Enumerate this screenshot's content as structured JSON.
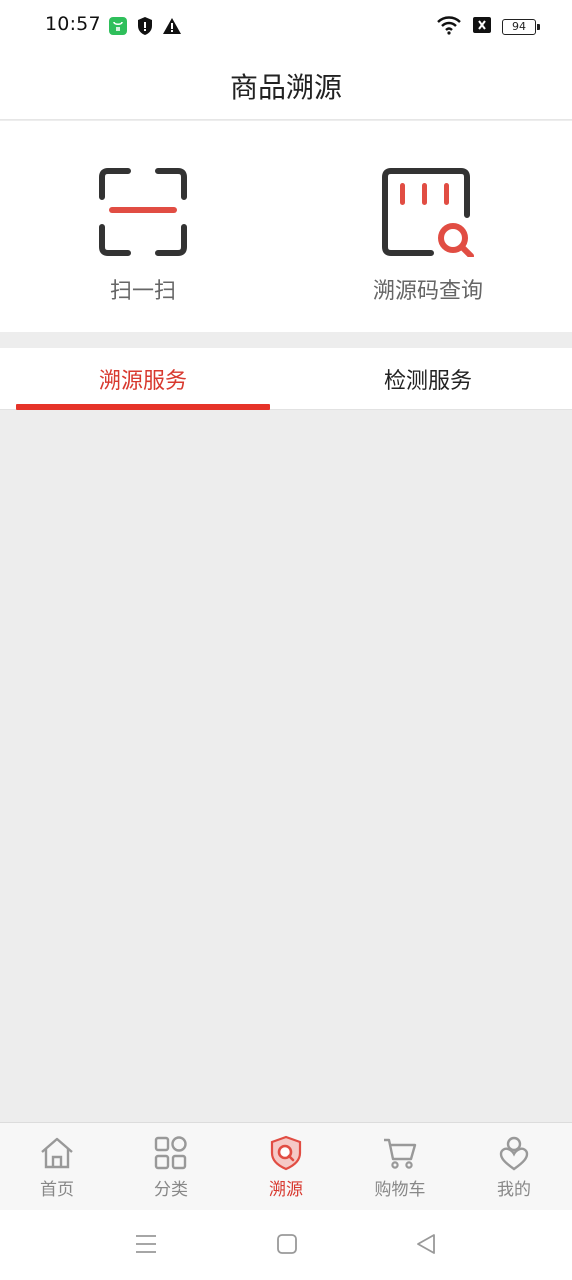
{
  "status_bar": {
    "time": "10:57",
    "battery": "94",
    "icons": [
      "app-notification-icon",
      "shield-icon",
      "warning-icon",
      "wifi-icon",
      "sim-x-icon",
      "battery-icon"
    ]
  },
  "header": {
    "title": "商品溯源"
  },
  "actions": [
    {
      "label": "扫一扫",
      "icon": "scan-icon"
    },
    {
      "label": "溯源码查询",
      "icon": "trace-code-search-icon"
    }
  ],
  "tabs": [
    {
      "label": "溯源服务",
      "active": true
    },
    {
      "label": "检测服务",
      "active": false
    }
  ],
  "bottom_nav": [
    {
      "label": "首页",
      "icon": "home-icon",
      "active": false
    },
    {
      "label": "分类",
      "icon": "category-grid-icon",
      "active": false
    },
    {
      "label": "溯源",
      "icon": "trace-shield-icon",
      "active": true
    },
    {
      "label": "购物车",
      "icon": "cart-icon",
      "active": false
    },
    {
      "label": "我的",
      "icon": "profile-icon",
      "active": false
    }
  ],
  "colors": {
    "accent": "#e63329",
    "text": "#222222",
    "muted": "#888888",
    "background": "#ededed"
  }
}
